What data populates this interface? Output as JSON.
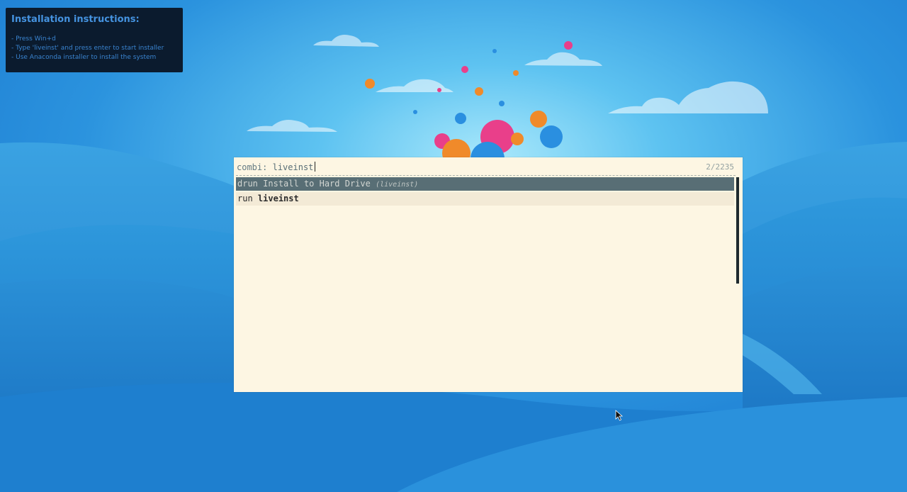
{
  "colors": {
    "sky_top": "#1f86d8",
    "sky_center": "#8fdcfa",
    "launcher_bg": "#fdf6e3",
    "selected_bg": "#586e75",
    "instructions_bg": "#0b1b2e",
    "instructions_text": "#3a84d0"
  },
  "instructions": {
    "title": "Installation instructions:",
    "lines": [
      "- Press  Win+d",
      "- Type  'liveinst'  and press enter to start installer",
      "- Use Anaconda installer to install the system"
    ]
  },
  "launcher": {
    "prompt_label": "combi:",
    "input_value": "liveinst",
    "counter": "2/2235",
    "results": [
      {
        "prefix": "drun",
        "text": "Install to Hard Drive",
        "detail": "(liveinst)",
        "selected": true
      },
      {
        "prefix": "run",
        "text": "liveinst",
        "detail": "",
        "selected": false
      }
    ]
  },
  "icons": {
    "pointer": "mouse-pointer-icon"
  }
}
